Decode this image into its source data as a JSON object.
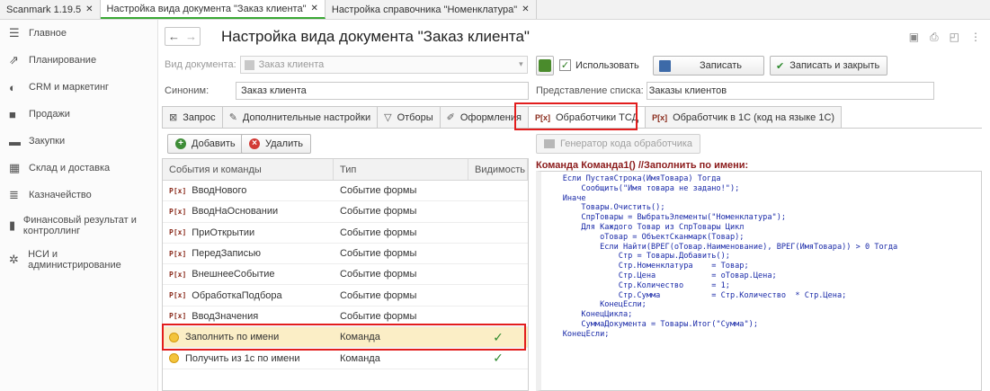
{
  "tabs": [
    {
      "label": "Scanmark 1.19.5",
      "active": false
    },
    {
      "label": "Настройка вида документа \"Заказ клиента\"",
      "active": true
    },
    {
      "label": "Настройка справочника \"Номенклатура\"",
      "active": false
    }
  ],
  "sidebar": {
    "items": [
      {
        "label": "Главное",
        "icon": "menu-icon"
      },
      {
        "label": "Планирование",
        "icon": "chart-icon"
      },
      {
        "label": "CRM и маркетинг",
        "icon": "crm-icon"
      },
      {
        "label": "Продажи",
        "icon": "bag-icon"
      },
      {
        "label": "Закупки",
        "icon": "cart-icon"
      },
      {
        "label": "Склад и доставка",
        "icon": "warehouse-icon"
      },
      {
        "label": "Казначейство",
        "icon": "money-icon"
      },
      {
        "label": "Финансовый результат и контроллинг",
        "icon": "bars-icon"
      },
      {
        "label": "НСИ и администрирование",
        "icon": "gear-icon"
      }
    ]
  },
  "header": {
    "title": "Настройка вида документа \"Заказ клиента\""
  },
  "form": {
    "doc_type_label": "Вид документа:",
    "doc_type_value": "Заказ клиента",
    "use_label": "Использовать",
    "save_label": "Записать",
    "save_close_label": "Записать и закрыть",
    "synonym_label": "Синоним:",
    "synonym_value": "Заказ клиента",
    "list_repr_label": "Представление списка:",
    "list_repr_value": "Заказы клиентов"
  },
  "form_tabs": [
    {
      "label": "Запрос"
    },
    {
      "label": "Дополнительные настройки"
    },
    {
      "label": "Отборы"
    },
    {
      "label": "Оформления"
    },
    {
      "label": "Обработчики ТСД"
    },
    {
      "label": "Обработчик в 1С (код на языке 1С)"
    }
  ],
  "left_panel": {
    "add_label": "Добавить",
    "delete_label": "Удалить",
    "columns": [
      "События и команды",
      "Тип",
      "Видимость"
    ],
    "rows": [
      {
        "name": "ВводНового",
        "type": "Событие формы",
        "visible": ""
      },
      {
        "name": "ВводНаОсновании",
        "type": "Событие формы",
        "visible": ""
      },
      {
        "name": "ПриОткрытии",
        "type": "Событие формы",
        "visible": ""
      },
      {
        "name": "ПередЗаписью",
        "type": "Событие формы",
        "visible": ""
      },
      {
        "name": "ВнешнееСобытие",
        "type": "Событие формы",
        "visible": ""
      },
      {
        "name": "ОбработкаПодбора",
        "type": "Событие формы",
        "visible": ""
      },
      {
        "name": "ВводЗначения",
        "type": "Событие формы",
        "visible": ""
      },
      {
        "name": "Заполнить по имени",
        "type": "Команда",
        "visible": "✓"
      },
      {
        "name": "Получить из 1с по имени",
        "type": "Команда",
        "visible": "✓"
      }
    ]
  },
  "right_panel": {
    "generator_label": "Генератор кода обработчика",
    "code_header": "Команда Команда1() //Заполнить по имени:",
    "code": "    Если ПустаяСтрока(ИмяТовара) Тогда\n        Сообщить(\"Имя товара не задано!\");\n    Иначе\n        Товары.Очистить();\n        СпрТовары = ВыбратьЭлементы(\"Номенклатура\");\n        Для Каждого Товар из СпрТовары Цикл\n            оТовар = ОбъектСканмарк(Товар);\n            Если Найти(ВРЕГ(оТовар.Наименование), ВРЕГ(ИмяТовара)) > 0 Тогда\n                Стр = Товары.Добавить();\n                Стр.Номенклатура    = Товар;\n                Стр.Цена            = оТовар.Цена;\n                Стр.Количество      = 1;\n                Стр.Сумма           = Стр.Количество  * Стр.Цена;\n            КонецЕсли;\n        КонецЦикла;\n        СуммаДокумента = Товары.Итог(\"Сумма\");\n    КонецЕсли;"
  }
}
